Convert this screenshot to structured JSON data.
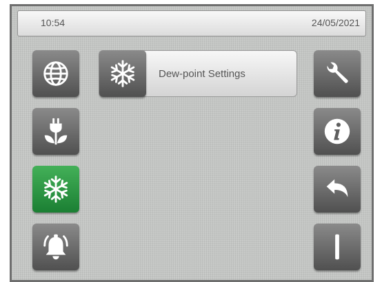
{
  "header": {
    "time": "10:54",
    "date": "24/05/2021"
  },
  "page": {
    "title": "Dew-point Settings",
    "title_icon": "snowflake-icon"
  },
  "left_nav": [
    {
      "name": "language",
      "icon": "globe-icon",
      "active": false
    },
    {
      "name": "energy",
      "icon": "plug-leaf-icon",
      "active": false
    },
    {
      "name": "dew-point",
      "icon": "snowflake-icon",
      "active": true
    },
    {
      "name": "alarms",
      "icon": "bell-icon",
      "active": false
    }
  ],
  "right_nav": [
    {
      "name": "service",
      "icon": "wrench-icon"
    },
    {
      "name": "info",
      "icon": "info-icon"
    },
    {
      "name": "back",
      "icon": "back-arrow-icon"
    },
    {
      "name": "power",
      "icon": "power-icon"
    }
  ],
  "colors": {
    "active": "#2e9a45",
    "button": "#6b6b6b",
    "background": "#c4c6c4"
  }
}
